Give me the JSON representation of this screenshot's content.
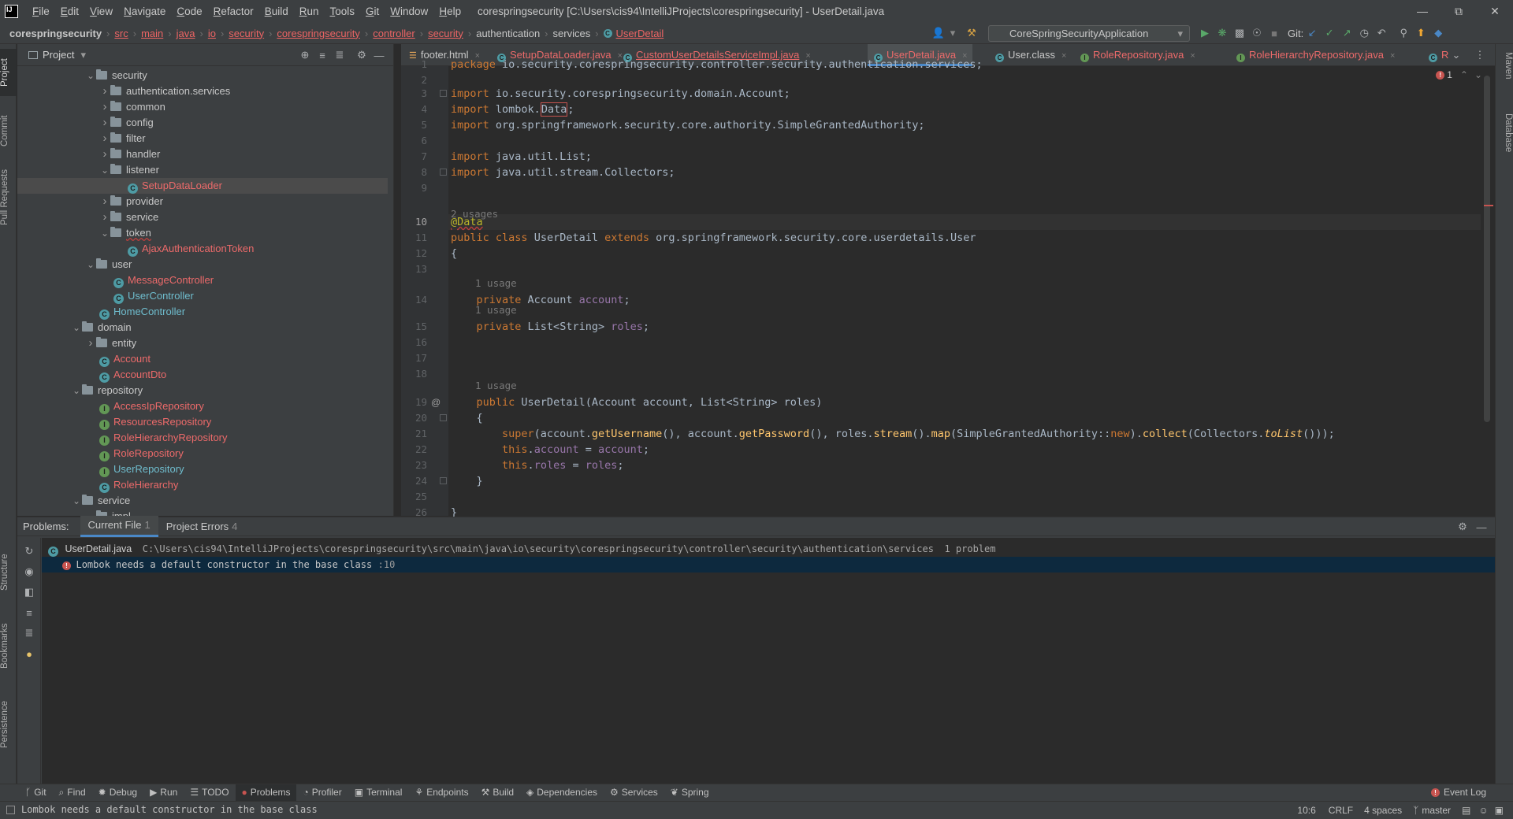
{
  "window": {
    "title": "corespringsecurity [C:\\Users\\cis94\\IntelliJProjects\\corespringsecurity] - UserDetail.java",
    "menu": [
      "File",
      "Edit",
      "View",
      "Navigate",
      "Code",
      "Refactor",
      "Build",
      "Run",
      "Tools",
      "Git",
      "Window",
      "Help"
    ]
  },
  "breadcrumbs": [
    {
      "t": "corespringsecurity",
      "k": "c"
    },
    {
      "t": "src",
      "k": "e"
    },
    {
      "t": "main",
      "k": "e"
    },
    {
      "t": "java",
      "k": "e"
    },
    {
      "t": "io",
      "k": "e"
    },
    {
      "t": "security",
      "k": "e"
    },
    {
      "t": "corespringsecurity",
      "k": "e"
    },
    {
      "t": "controller",
      "k": "e"
    },
    {
      "t": "security",
      "k": "e"
    },
    {
      "t": "authentication",
      "k": "n"
    },
    {
      "t": "services",
      "k": "n"
    },
    {
      "t": "UserDetail",
      "k": "e"
    }
  ],
  "run_config": "CoreSpringSecurityApplication",
  "git_label": "Git:",
  "left_stripe": [
    "Project",
    "Commit",
    "Pull Requests",
    "Structure",
    "Bookmarks",
    "Persistence"
  ],
  "right_stripe": [
    "Maven",
    "Database"
  ],
  "project": {
    "title": "Project",
    "tree": [
      {
        "label": "security",
        "indent": 5,
        "type": "folder",
        "open": true,
        "color": "plain"
      },
      {
        "label": "authentication.services",
        "indent": 6,
        "type": "folder",
        "open": false,
        "color": "plain"
      },
      {
        "label": "common",
        "indent": 6,
        "type": "folder",
        "open": false,
        "color": "plain"
      },
      {
        "label": "config",
        "indent": 6,
        "type": "folder",
        "open": false,
        "color": "plain"
      },
      {
        "label": "filter",
        "indent": 6,
        "type": "folder",
        "open": false,
        "color": "plain"
      },
      {
        "label": "handler",
        "indent": 6,
        "type": "folder",
        "open": false,
        "color": "plain"
      },
      {
        "label": "listener",
        "indent": 6,
        "type": "folder",
        "open": true,
        "color": "plain"
      },
      {
        "label": "SetupDataLoader",
        "indent": 8,
        "type": "class",
        "color": "red",
        "selected": true
      },
      {
        "label": "provider",
        "indent": 6,
        "type": "folder",
        "open": false,
        "color": "plain"
      },
      {
        "label": "service",
        "indent": 6,
        "type": "folder",
        "open": false,
        "color": "plain"
      },
      {
        "label": "token",
        "indent": 6,
        "type": "folder",
        "open": true,
        "color": "plain"
      },
      {
        "label": "AjaxAuthenticationToken",
        "indent": 8,
        "type": "class",
        "color": "red"
      },
      {
        "label": "user",
        "indent": 5,
        "type": "folder",
        "open": true,
        "color": "plain"
      },
      {
        "label": "MessageController",
        "indent": 7,
        "type": "class",
        "color": "red"
      },
      {
        "label": "UserController",
        "indent": 7,
        "type": "class",
        "color": "teal"
      },
      {
        "label": "HomeController",
        "indent": 6,
        "type": "class",
        "color": "teal"
      },
      {
        "label": "domain",
        "indent": 4,
        "type": "folder",
        "open": true,
        "color": "plain"
      },
      {
        "label": "entity",
        "indent": 5,
        "type": "folder",
        "open": false,
        "color": "plain"
      },
      {
        "label": "Account",
        "indent": 6,
        "type": "class",
        "color": "red"
      },
      {
        "label": "AccountDto",
        "indent": 6,
        "type": "class",
        "color": "red"
      },
      {
        "label": "repository",
        "indent": 4,
        "type": "folder",
        "open": true,
        "color": "plain"
      },
      {
        "label": "AccessIpRepository",
        "indent": 6,
        "type": "intf",
        "color": "red"
      },
      {
        "label": "ResourcesRepository",
        "indent": 6,
        "type": "intf",
        "color": "red"
      },
      {
        "label": "RoleHierarchyRepository",
        "indent": 6,
        "type": "intf",
        "color": "red"
      },
      {
        "label": "RoleRepository",
        "indent": 6,
        "type": "intf",
        "color": "red"
      },
      {
        "label": "UserRepository",
        "indent": 6,
        "type": "intf",
        "color": "teal"
      },
      {
        "label": "RoleHierarchy",
        "indent": 6,
        "type": "class",
        "color": "red"
      },
      {
        "label": "service",
        "indent": 4,
        "type": "folder",
        "open": true,
        "color": "plain"
      },
      {
        "label": "impl",
        "indent": 5,
        "type": "folder",
        "open": true,
        "color": "plain"
      }
    ]
  },
  "tabs": [
    {
      "label": "footer.html",
      "icon": "html",
      "color": "plain"
    },
    {
      "label": "SetupDataLoader.java",
      "icon": "class",
      "color": "red"
    },
    {
      "label": "CustomUserDetailsServiceImpl.java",
      "icon": "class",
      "color": "red",
      "underline": true
    },
    {
      "label": "UserDetail.java",
      "icon": "class",
      "color": "red",
      "active": true
    },
    {
      "label": "User.class",
      "icon": "class",
      "color": "plain"
    },
    {
      "label": "RoleRepository.java",
      "icon": "intf",
      "color": "red"
    },
    {
      "label": "RoleHierarchyRepository.java",
      "icon": "intf",
      "color": "red"
    },
    {
      "label": "R",
      "icon": "class",
      "color": "red"
    }
  ],
  "editor": {
    "error_count": "1",
    "lines": [
      {
        "n": "1",
        "code": "package io.security.corespringsecurity.controller.security.authentication.services;"
      },
      {
        "n": "2",
        "code": ""
      },
      {
        "n": "3",
        "code": "import io.security.corespringsecurity.domain.Account;"
      },
      {
        "n": "4",
        "code": "import lombok.Data;"
      },
      {
        "n": "5",
        "code": "import org.springframework.security.core.authority.SimpleGrantedAuthority;"
      },
      {
        "n": "6",
        "code": ""
      },
      {
        "n": "7",
        "code": "import java.util.List;"
      },
      {
        "n": "8",
        "code": "import java.util.stream.Collectors;"
      },
      {
        "n": "9",
        "code": ""
      },
      {
        "n": "10",
        "code": "@Data"
      },
      {
        "n": "11",
        "code": "public class UserDetail extends org.springframework.security.core.userdetails.User"
      },
      {
        "n": "12",
        "code": "{"
      },
      {
        "n": "13",
        "code": ""
      },
      {
        "n": "14",
        "code": "    private Account account;"
      },
      {
        "n": "15",
        "code": "    private List<String> roles;"
      },
      {
        "n": "16",
        "code": ""
      },
      {
        "n": "17",
        "code": ""
      },
      {
        "n": "18",
        "code": ""
      },
      {
        "n": "19",
        "code": "    public UserDetail(Account account, List<String> roles)"
      },
      {
        "n": "20",
        "code": "    {"
      },
      {
        "n": "21",
        "code": "        super(account.getUsername(), account.getPassword(), roles.stream().map(SimpleGrantedAuthority::new).collect(Collectors.toList()));"
      },
      {
        "n": "22",
        "code": "        this.account = account;"
      },
      {
        "n": "23",
        "code": "        this.roles = roles;"
      },
      {
        "n": "24",
        "code": "    }"
      },
      {
        "n": "25",
        "code": ""
      },
      {
        "n": "26",
        "code": "}"
      }
    ],
    "hints": [
      "2 usages",
      "1 usage",
      "1 usage",
      "1 usage"
    ]
  },
  "problems": {
    "label": "Problems:",
    "tabs": [
      {
        "label": "Current File",
        "count": "1",
        "active": true
      },
      {
        "label": "Project Errors",
        "count": "4"
      }
    ],
    "file": "UserDetail.java",
    "path": "C:\\Users\\cis94\\IntelliJProjects\\corespringsecurity\\src\\main\\java\\io\\security\\corespringsecurity\\controller\\security\\authentication\\services",
    "summary": "1 problem",
    "message": "Lombok needs a default constructor in the base class",
    "msg_line": ":10"
  },
  "toolwindows": [
    "Git",
    "Find",
    "Debug",
    "Run",
    "TODO",
    "Problems",
    "Profiler",
    "Terminal",
    "Endpoints",
    "Build",
    "Dependencies",
    "Services",
    "Spring"
  ],
  "event_log": "Event Log",
  "status": {
    "message": "Lombok needs a default constructor in the base class",
    "position": "10:6",
    "eol": "CRLF",
    "indent": "4 spaces",
    "branch": "master"
  }
}
